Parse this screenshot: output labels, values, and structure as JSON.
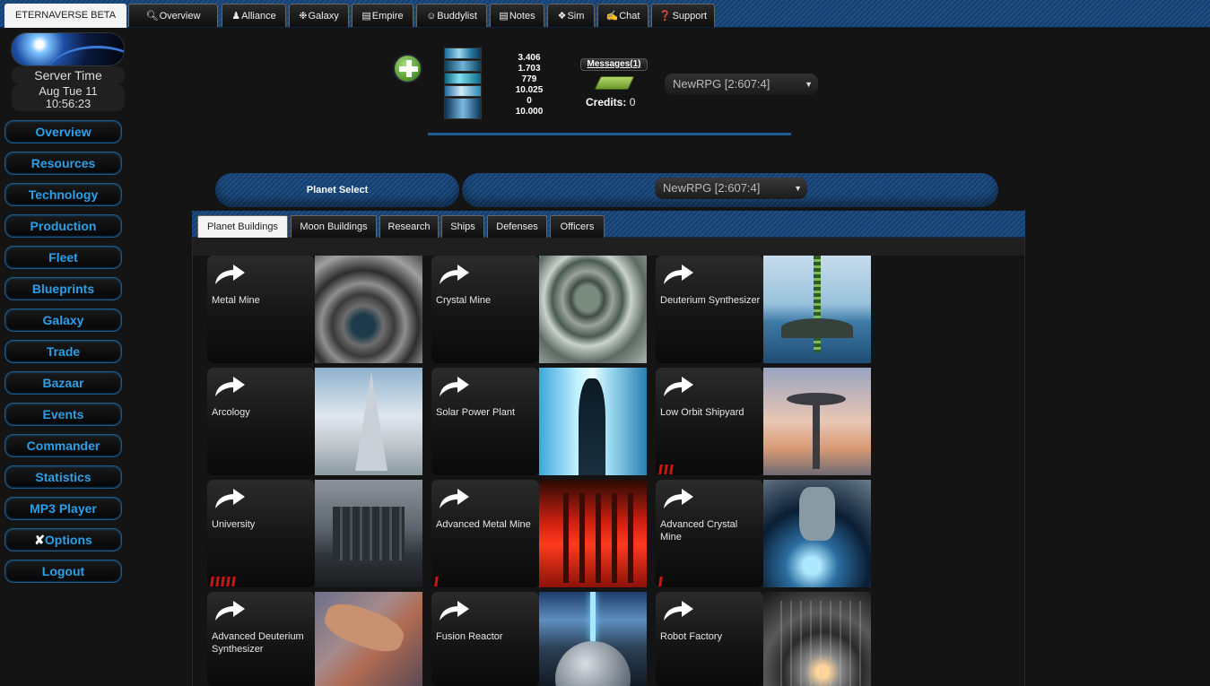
{
  "topbar": {
    "brand": "ETERNAVERSE BETA",
    "tabs": [
      {
        "label": "Overview",
        "icon": "magnifier-icon"
      },
      {
        "label": "Alliance",
        "icon": "people-icon"
      },
      {
        "label": "Galaxy",
        "icon": "galaxy-icon"
      },
      {
        "label": "Empire",
        "icon": "chart-icon"
      },
      {
        "label": "Buddylist",
        "icon": "buddy-icon"
      },
      {
        "label": "Notes",
        "icon": "note-icon"
      },
      {
        "label": "Sim",
        "icon": "sim-icon"
      },
      {
        "label": "Chat",
        "icon": "chat-icon"
      },
      {
        "label": "Support",
        "icon": "support-icon"
      }
    ]
  },
  "sidebar": {
    "server_time_label": "Server Time",
    "date": "Aug Tue 11",
    "time": "10:56:23",
    "items": [
      "Overview",
      "Resources",
      "Technology",
      "Production",
      "Fleet",
      "Blueprints",
      "Galaxy",
      "Trade",
      "Bazaar",
      "Events",
      "Commander",
      "Statistics",
      "MP3 Player",
      "Options",
      "Logout"
    ]
  },
  "resources": {
    "values": [
      "3.406",
      "1.703",
      "779",
      "10.025",
      "0",
      "10.000"
    ],
    "messages_label": "Messages(1)",
    "credits_label": "Credits:",
    "credits_value": "0",
    "planet": "NewRPG [2:607:4]"
  },
  "planet_select": {
    "label": "Planet Select",
    "planet": "NewRPG [2:607:4]"
  },
  "content_tabs": [
    "Planet Buildings",
    "Moon Buildings",
    "Research",
    "Ships",
    "Defenses",
    "Officers"
  ],
  "buildings": [
    {
      "name": "Metal Mine",
      "level": 0
    },
    {
      "name": "Crystal Mine",
      "level": 0
    },
    {
      "name": "Deuterium Synthesizer",
      "level": 0
    },
    {
      "name": "Arcology",
      "level": 0
    },
    {
      "name": "Solar Power Plant",
      "level": 0
    },
    {
      "name": "Low Orbit Shipyard",
      "level": 3
    },
    {
      "name": "University",
      "level": 5
    },
    {
      "name": "Advanced Metal Mine",
      "level": 1
    },
    {
      "name": "Advanced Crystal Mine",
      "level": 1
    },
    {
      "name": "Advanced Deuterium Synthesizer",
      "level": 0
    },
    {
      "name": "Fusion Reactor",
      "level": 0
    },
    {
      "name": "Robot Factory",
      "level": 0
    }
  ],
  "colors": {
    "accent_blue": "#1d4f86",
    "nav_text": "#2aa0e8",
    "level_bar": "#d41212"
  }
}
